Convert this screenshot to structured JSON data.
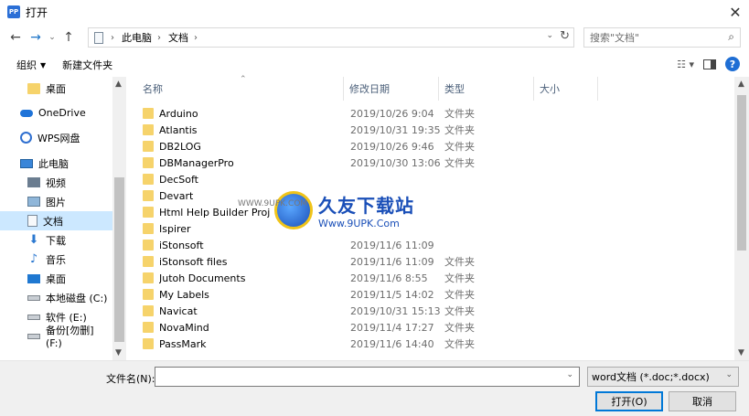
{
  "window": {
    "title": "打开",
    "icon_text": "PP"
  },
  "nav": {
    "breadcrumb": [
      "此电脑",
      "文档"
    ]
  },
  "search": {
    "placeholder": "搜索\"文档\""
  },
  "toolbar": {
    "organize": "组织",
    "new_folder": "新建文件夹"
  },
  "sidebar": {
    "items": [
      {
        "label": "桌面",
        "icon": "folder-icon"
      },
      {
        "label": "OneDrive",
        "icon": "cloud-icon"
      },
      {
        "label": "WPS网盘",
        "icon": "wps-icon"
      },
      {
        "label": "此电脑",
        "icon": "computer-icon"
      },
      {
        "label": "视频",
        "icon": "video-icon"
      },
      {
        "label": "图片",
        "icon": "picture-icon"
      },
      {
        "label": "文档",
        "icon": "document-icon"
      },
      {
        "label": "下载",
        "icon": "download-icon"
      },
      {
        "label": "音乐",
        "icon": "music-icon"
      },
      {
        "label": "桌面",
        "icon": "desktop-icon"
      },
      {
        "label": "本地磁盘 (C:)",
        "icon": "drive-icon"
      },
      {
        "label": "软件 (E:)",
        "icon": "drive-icon"
      },
      {
        "label": "备份[勿删] (F:)",
        "icon": "drive-icon"
      }
    ]
  },
  "columns": {
    "name": "名称",
    "date": "修改日期",
    "type": "类型",
    "size": "大小"
  },
  "files": [
    {
      "name": "Arduino",
      "date": "2019/10/26 9:04",
      "type": "文件夹"
    },
    {
      "name": "Atlantis",
      "date": "2019/10/31 19:35",
      "type": "文件夹"
    },
    {
      "name": "DB2LOG",
      "date": "2019/10/26 9:46",
      "type": "文件夹"
    },
    {
      "name": "DBManagerPro",
      "date": "2019/10/30 13:06",
      "type": "文件夹"
    },
    {
      "name": "DecSoft",
      "date": "",
      "type": ""
    },
    {
      "name": "Devart",
      "date": "",
      "type": ""
    },
    {
      "name": "Html Help Builder Projec",
      "date": "",
      "type": ""
    },
    {
      "name": "Ispirer",
      "date": "",
      "type": ""
    },
    {
      "name": "iStonsoft",
      "date": "2019/11/6 11:09",
      "type": ""
    },
    {
      "name": "iStonsoft files",
      "date": "2019/11/6 11:09",
      "type": "文件夹"
    },
    {
      "name": "Jutoh Documents",
      "date": "2019/11/6 8:55",
      "type": "文件夹"
    },
    {
      "name": "My Labels",
      "date": "2019/11/5 14:02",
      "type": "文件夹"
    },
    {
      "name": "Navicat",
      "date": "2019/10/31 15:13",
      "type": "文件夹"
    },
    {
      "name": "NovaMind",
      "date": "2019/11/4 17:27",
      "type": "文件夹"
    },
    {
      "name": "PassMark",
      "date": "2019/11/6 14:40",
      "type": "文件夹"
    }
  ],
  "watermark": {
    "title": "久友下载站",
    "url": "Www.9UPK.Com",
    "left_text": "WWW.9UPK.COM"
  },
  "bottom": {
    "filename_label": "文件名(N):",
    "filename_value": "",
    "filter": "word文档 (*.doc;*.docx)",
    "open": "打开(O)",
    "cancel": "取消"
  }
}
